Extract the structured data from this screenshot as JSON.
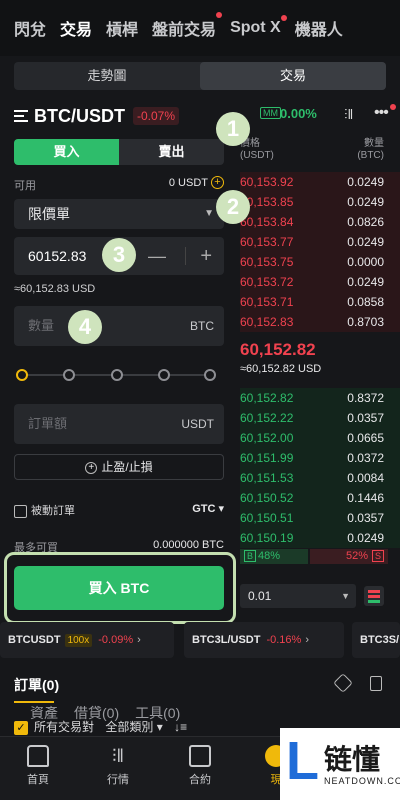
{
  "topnav": {
    "tabs": [
      "閃兌",
      "交易",
      "槓桿",
      "盤前交易",
      "Spot X",
      "機器人"
    ]
  },
  "view_toggle": {
    "chart": "走勢圖",
    "trade": "交易"
  },
  "pair": {
    "symbol": "BTC/USDT",
    "change": "-0.07%",
    "mm_label": "MM",
    "mm_pct": "0.00%"
  },
  "side": {
    "buy": "買入",
    "sell": "賣出"
  },
  "available": {
    "label": "可用",
    "value": "0 USDT",
    "add": "+"
  },
  "order_type": "限價單",
  "price_input": {
    "value": "60152.83",
    "minus": "—",
    "plus": "+"
  },
  "price_usd": "≈60,152.83 USD",
  "quantity": {
    "placeholder": "數量",
    "unit": "BTC"
  },
  "order_amount": {
    "placeholder": "訂單額",
    "unit": "USDT"
  },
  "slider_pct": 0,
  "tpsl": "止盈/止損",
  "passive": {
    "label": "被動訂單",
    "tif": "GTC ▾"
  },
  "max_buy": {
    "label": "最多可買",
    "value": "0.000000 BTC"
  },
  "buy_button": "買入 BTC",
  "orderbook": {
    "price_header": [
      "價格",
      "(USDT)"
    ],
    "qty_header": [
      "數量",
      "(BTC)"
    ],
    "asks": [
      {
        "p": "60,153.92",
        "q": "0.0249"
      },
      {
        "p": "60,153.85",
        "q": "0.0249"
      },
      {
        "p": "60,153.84",
        "q": "0.0826"
      },
      {
        "p": "60,153.77",
        "q": "0.0249"
      },
      {
        "p": "60,153.75",
        "q": "0.0000"
      },
      {
        "p": "60,153.72",
        "q": "0.0249"
      },
      {
        "p": "60,153.71",
        "q": "0.0858"
      },
      {
        "p": "60,152.83",
        "q": "0.8703"
      }
    ],
    "last_price": "60,152.82",
    "last_usd": "≈60,152.82 USD",
    "bids": [
      {
        "p": "60,152.82",
        "q": "0.8372"
      },
      {
        "p": "60,152.22",
        "q": "0.0357"
      },
      {
        "p": "60,152.00",
        "q": "0.0665"
      },
      {
        "p": "60,151.99",
        "q": "0.0372"
      },
      {
        "p": "60,151.53",
        "q": "0.0084"
      },
      {
        "p": "60,150.52",
        "q": "0.1446"
      },
      {
        "p": "60,150.51",
        "q": "0.0357"
      },
      {
        "p": "60,150.19",
        "q": "0.0249"
      }
    ],
    "buy_ratio": "48%",
    "sell_ratio": "52%",
    "buy_tag": "B",
    "sell_tag": "S",
    "depth": "0.01"
  },
  "tickers": [
    {
      "name": "BTCUSDT",
      "lev": "100x",
      "chg": "-0.09%",
      "arrow": "›"
    },
    {
      "name": "BTC3L/USDT",
      "lev": "",
      "chg": "-0.16%",
      "arrow": "›"
    },
    {
      "name": "BTC3S/",
      "lev": "",
      "chg": "",
      "arrow": ""
    }
  ],
  "order_tabs": [
    "訂單(0)",
    "資產",
    "借貸(0)",
    "工具(0)"
  ],
  "filter": {
    "all_pairs": "所有交易對",
    "all_types": "全部類別 ▾",
    "sort": "↓≡"
  },
  "bottom_nav": [
    "首頁",
    "行情",
    "合約",
    "現"
  ],
  "badges": [
    "1",
    "2",
    "3",
    "4"
  ],
  "watermark": {
    "cn": "链懂",
    "en": "NEATDOWN.COM",
    "L": "L"
  }
}
